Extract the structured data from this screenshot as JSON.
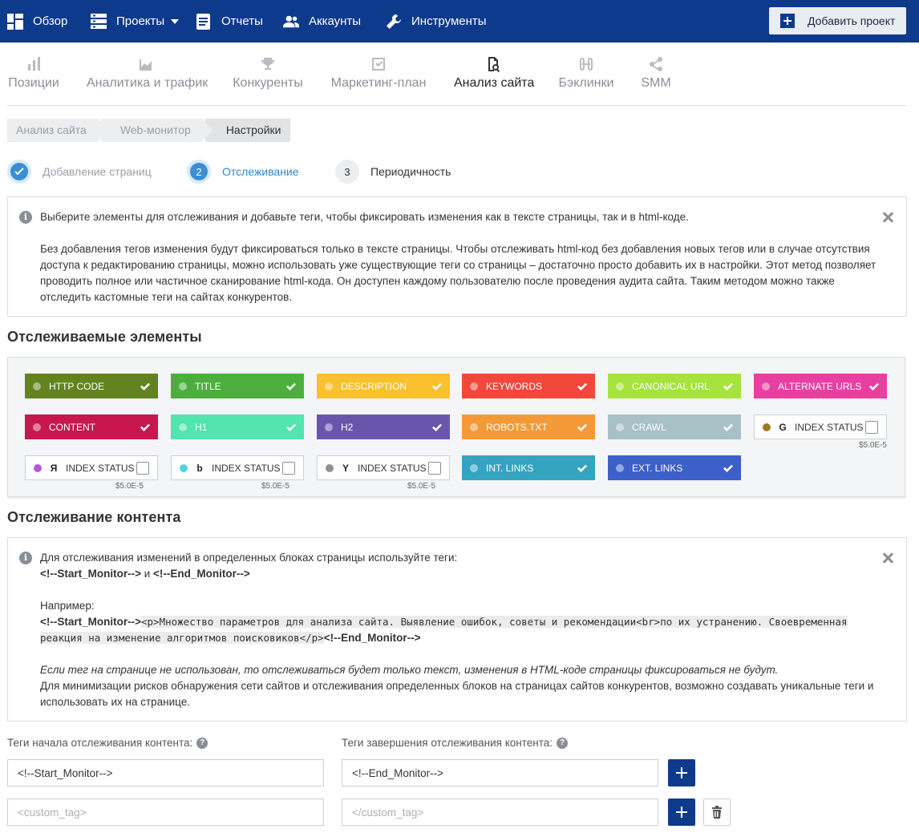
{
  "topnav": {
    "items": [
      {
        "label": "Обзор",
        "icon": "dashboard-icon"
      },
      {
        "label": "Проекты",
        "icon": "projects-icon"
      },
      {
        "label": "Отчеты",
        "icon": "reports-icon"
      },
      {
        "label": "Аккаунты",
        "icon": "accounts-icon"
      },
      {
        "label": "Инструменты",
        "icon": "tools-icon"
      }
    ],
    "add_project": "Добавить проект",
    "bg_color": "#0e3a8c"
  },
  "modules": [
    {
      "label": "Позиции",
      "icon": "bar-chart-icon"
    },
    {
      "label": "Аналитика и трафик",
      "icon": "area-chart-icon"
    },
    {
      "label": "Конкуренты",
      "icon": "trophy-icon"
    },
    {
      "label": "Маркетинг-план",
      "icon": "checkbox-icon"
    },
    {
      "label": "Анализ сайта",
      "icon": "site-audit-icon",
      "active": true
    },
    {
      "label": "Бэклинки",
      "icon": "backlinks-icon"
    },
    {
      "label": "SMM",
      "icon": "share-icon"
    }
  ],
  "breadcrumbs": [
    "Анализ сайта",
    "Web-монитор",
    "Настройки"
  ],
  "steps": [
    {
      "number": "1",
      "label": "Добавление страниц",
      "state": "done"
    },
    {
      "number": "2",
      "label": "Отслеживание",
      "state": "current"
    },
    {
      "number": "3",
      "label": "Периодичность",
      "state": "next"
    }
  ],
  "info1": {
    "line1": "Выберите элементы для отслеживания и добавьте теги, чтобы фиксировать изменения как в тексте страницы, так и в html-коде.",
    "para": "Без добавления тегов изменения будут фиксироваться только в тексте страницы. Чтобы отслеживать html-код без добавления новых тегов или в случае отсутствия доступа к редактированию страницы, можно использовать уже существующие теги со страницы – достаточно просто добавить их в настройки. Этот метод позволяет проводить полное или частичное сканирование html-кода. Он доступен каждому пользователю после проведения аудита сайта. Таким методом можно также отследить кастомные теги на сайтах конкурентов."
  },
  "tracked_title": "Отслеживаемые элементы",
  "chips": [
    {
      "label": "HTTP CODE",
      "color": "#62831f",
      "checked": true
    },
    {
      "label": "TITLE",
      "color": "#4caf3d",
      "checked": true
    },
    {
      "label": "DESCRIPTION",
      "color": "#fbc02d",
      "checked": true
    },
    {
      "label": "KEYWORDS",
      "color": "#f2473b",
      "checked": true
    },
    {
      "label": "CANONICAL URL",
      "color": "#a6e33d",
      "checked": true
    },
    {
      "label": "ALTERNATE URLS",
      "color": "#e83fa1",
      "checked": true
    },
    {
      "label": "CONTENT",
      "color": "#c8174f",
      "checked": true
    },
    {
      "label": "H1",
      "color": "#52e4b1",
      "checked": true
    },
    {
      "label": "H2",
      "color": "#6a55ad",
      "checked": true
    },
    {
      "label": "ROBOTS.TXT",
      "color": "#f39a36",
      "checked": true
    },
    {
      "label": "CRAWL",
      "color": "#a8c1c7",
      "checked": true
    },
    {
      "label": "INDEX STATUS",
      "color": "#9c7a20",
      "checked": false,
      "engine": "G",
      "price": "$5.0E-5"
    },
    {
      "label": "INDEX STATUS",
      "color": "#b856d8",
      "checked": false,
      "engine": "Я",
      "price": "$5.0E-5"
    },
    {
      "label": "INDEX STATUS",
      "color": "#4fd4e0",
      "checked": false,
      "engine": "b",
      "price": "$5.0E-5"
    },
    {
      "label": "INDEX STATUS",
      "color": "#8e8e96",
      "checked": false,
      "engine": "Y",
      "price": "$5.0E-5"
    },
    {
      "label": "INT. LINKS",
      "color": "#35a4c0",
      "checked": true
    },
    {
      "label": "EXT. LINKS",
      "color": "#3d5fc9",
      "checked": true
    }
  ],
  "content_title": "Отслеживание контента",
  "info2": {
    "line1": "Для отслеживания изменений в определенных блоках страницы используйте теги:",
    "start_tag": "<!--Start_Monitor-->",
    "and": " и ",
    "end_tag": "<!--End_Monitor-->",
    "example_label": "Например:",
    "example_code": "<p>Множество параметров для анализа сайта. Выявление ошибок, советы и рекомендации<br>по их устранению. Своевременная реакция на изменение алгоритмов поисковиков</p>",
    "italic_note": "Если тег на странице не использован, то отслеживаться будет только текст, изменения в HTML-коде страницы фиксироваться не будут.",
    "last_para": "Для минимизации рисков обнаружения сети сайтов и отслеживания определенных блоков на страницах сайтов конкурентов, возможно создавать уникальные теги и использовать их на странице."
  },
  "tags": {
    "start_label": "Теги начала отслеживания контента:",
    "end_label": "Теги завершения отслеживания контента:",
    "q": "?",
    "start_value": "<!--Start_Monitor-->",
    "end_value": "<!--End_Monitor-->",
    "start_placeholder": "<custom_tag>",
    "end_placeholder": "</custom_tag>"
  }
}
